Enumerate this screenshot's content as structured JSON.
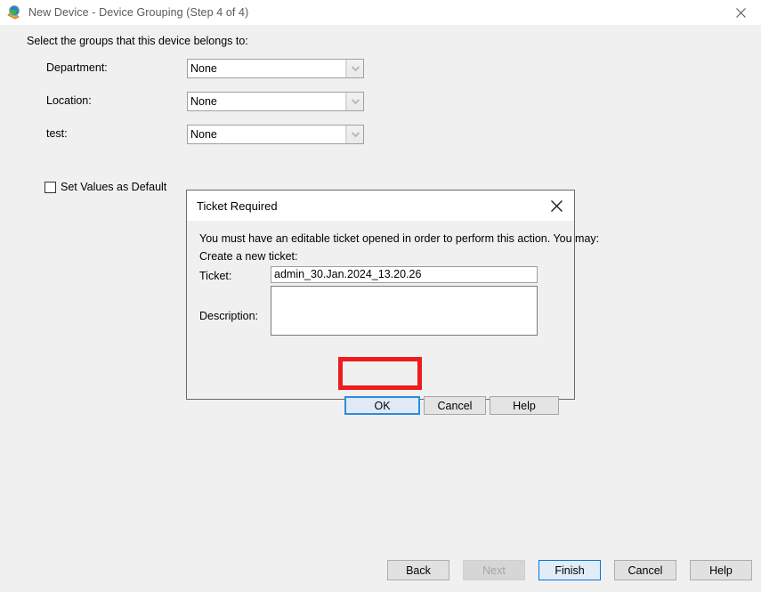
{
  "window": {
    "title": "New Device - Device Grouping (Step 4 of 4)",
    "icon": "globe-icon",
    "close_icon": "close-icon"
  },
  "wizard": {
    "intro": "Select the groups that this device belongs to:",
    "fields": [
      {
        "label": "Department:",
        "value": "None"
      },
      {
        "label": "Location:",
        "value": "None"
      },
      {
        "label": "test:",
        "value": "None"
      }
    ],
    "checkbox": {
      "label": "Set Values as Default",
      "checked": false
    },
    "footer_buttons": [
      {
        "label": "Back",
        "state": "enabled"
      },
      {
        "label": "Next",
        "state": "disabled"
      },
      {
        "label": "Finish",
        "state": "default"
      },
      {
        "label": "Cancel",
        "state": "enabled"
      },
      {
        "label": "Help",
        "state": "enabled"
      }
    ]
  },
  "dialog": {
    "title": "Ticket Required",
    "close_icon": "close-icon",
    "message_line1": "You must have an editable ticket opened in order to perform this action. You may:",
    "message_line2": "Create a new ticket:",
    "ticket_label": "Ticket:",
    "ticket_value": "admin_30.Jan.2024_13.20.26",
    "description_label": "Description:",
    "description_value": "",
    "buttons": [
      {
        "label": "OK",
        "state": "focused"
      },
      {
        "label": "Cancel",
        "state": "enabled"
      },
      {
        "label": "Help",
        "state": "enabled"
      }
    ]
  },
  "annotation": {
    "highlight_color": "#ee1c1c",
    "target": "OK"
  }
}
